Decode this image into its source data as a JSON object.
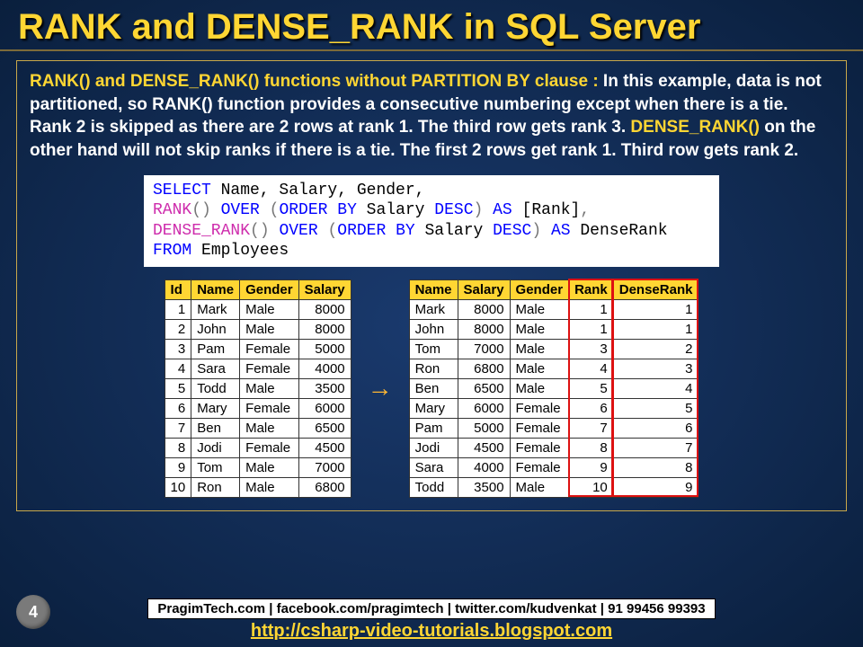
{
  "title": "RANK and DENSE_RANK in SQL Server",
  "explain": {
    "lead": "RANK() and DENSE_RANK() functions without PARTITION BY clause : ",
    "body1": "In this example, data is not partitioned, so RANK() function provides a consecutive numbering except when there is a tie. Rank 2 is skipped as there are 2 rows at rank 1. The third row gets rank 3. ",
    "dense": "DENSE_RANK()",
    "body2": " on the other hand will not skip ranks if there is a tie. The first 2 rows get rank 1. Third row gets rank 2."
  },
  "sql": {
    "l1a": "SELECT",
    "l1b": " Name, Salary, Gender,",
    "l2a": "RANK",
    "l2b": "()",
    "l2c": " OVER ",
    "l2d": "(",
    "l2e": "ORDER BY",
    "l2f": " Salary ",
    "l2g": "DESC",
    "l2h": ")",
    "l2i": " AS ",
    "l2j": "[Rank]",
    "l2k": ",",
    "l3a": "DENSE_RANK",
    "l3b": "()",
    "l3c": " OVER ",
    "l3d": "(",
    "l3e": "ORDER BY",
    "l3f": " Salary ",
    "l3g": "DESC",
    "l3h": ")",
    "l3i": " AS ",
    "l3j": "DenseRank",
    "l4a": "FROM",
    "l4b": " Employees"
  },
  "src": {
    "headers": [
      "Id",
      "Name",
      "Gender",
      "Salary"
    ],
    "rows": [
      [
        1,
        "Mark",
        "Male",
        8000
      ],
      [
        2,
        "John",
        "Male",
        8000
      ],
      [
        3,
        "Pam",
        "Female",
        5000
      ],
      [
        4,
        "Sara",
        "Female",
        4000
      ],
      [
        5,
        "Todd",
        "Male",
        3500
      ],
      [
        6,
        "Mary",
        "Female",
        6000
      ],
      [
        7,
        "Ben",
        "Male",
        6500
      ],
      [
        8,
        "Jodi",
        "Female",
        4500
      ],
      [
        9,
        "Tom",
        "Male",
        7000
      ],
      [
        10,
        "Ron",
        "Male",
        6800
      ]
    ]
  },
  "res": {
    "headers": [
      "Name",
      "Salary",
      "Gender",
      "Rank",
      "DenseRank"
    ],
    "rows": [
      [
        "Mark",
        8000,
        "Male",
        1,
        1
      ],
      [
        "John",
        8000,
        "Male",
        1,
        1
      ],
      [
        "Tom",
        7000,
        "Male",
        3,
        2
      ],
      [
        "Ron",
        6800,
        "Male",
        4,
        3
      ],
      [
        "Ben",
        6500,
        "Male",
        5,
        4
      ],
      [
        "Mary",
        6000,
        "Female",
        6,
        5
      ],
      [
        "Pam",
        5000,
        "Female",
        7,
        6
      ],
      [
        "Jodi",
        4500,
        "Female",
        8,
        7
      ],
      [
        "Sara",
        4000,
        "Female",
        9,
        8
      ],
      [
        "Todd",
        3500,
        "Male",
        10,
        9
      ]
    ]
  },
  "arrow": "→",
  "footer": {
    "box": "PragimTech.com | facebook.com/pragimtech | twitter.com/kudvenkat | 91 99456 99393",
    "link": "http://csharp-video-tutorials.blogspot.com"
  },
  "page": "4"
}
